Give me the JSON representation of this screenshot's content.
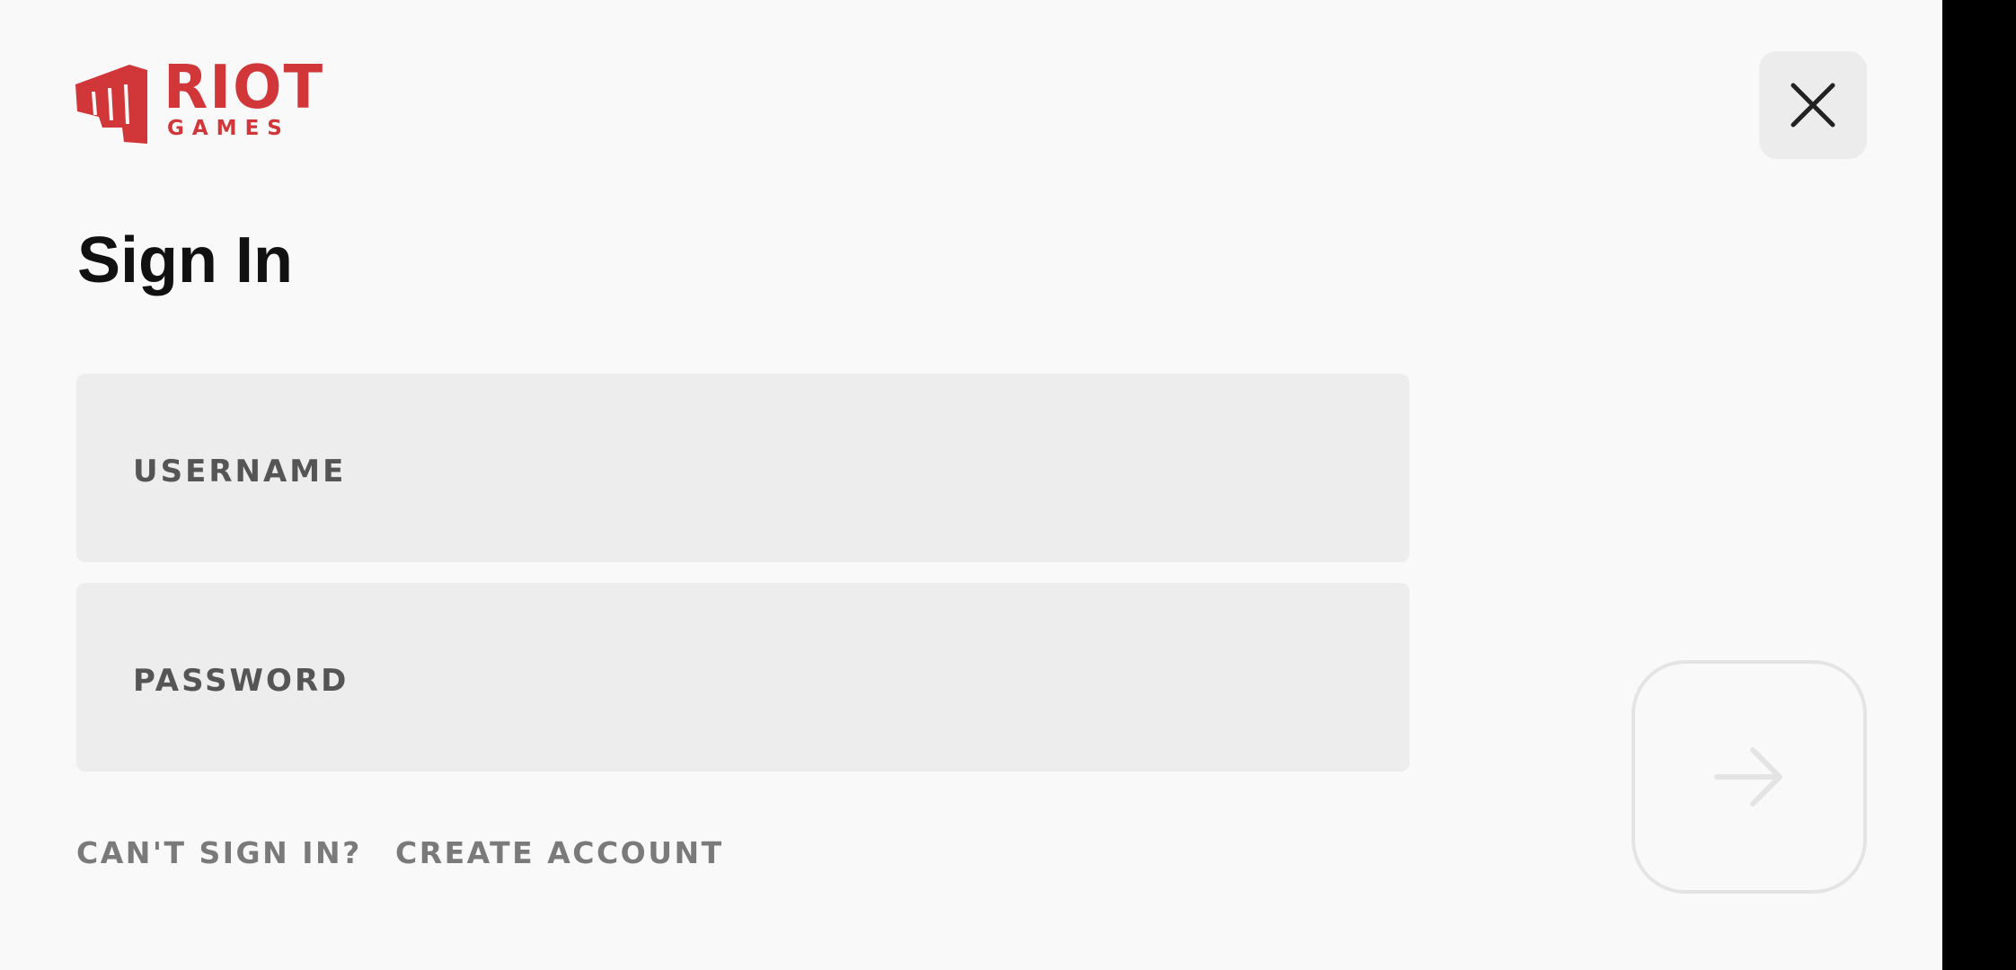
{
  "brand": {
    "logo_top": "RIOT",
    "logo_bottom": "GAMES",
    "color": "#d13639"
  },
  "header": {
    "title": "Sign In",
    "close_icon": "close-icon"
  },
  "form": {
    "username_label": "USERNAME",
    "password_label": "PASSWORD"
  },
  "links": {
    "cant_sign_in": "CAN'T SIGN IN?",
    "create_account": "CREATE ACCOUNT"
  },
  "submit": {
    "icon": "arrow-right-icon",
    "state": "disabled"
  },
  "colors": {
    "background": "#f9f9f9",
    "field": "#ededed",
    "label": "#555555",
    "link": "#7a7a7a"
  }
}
